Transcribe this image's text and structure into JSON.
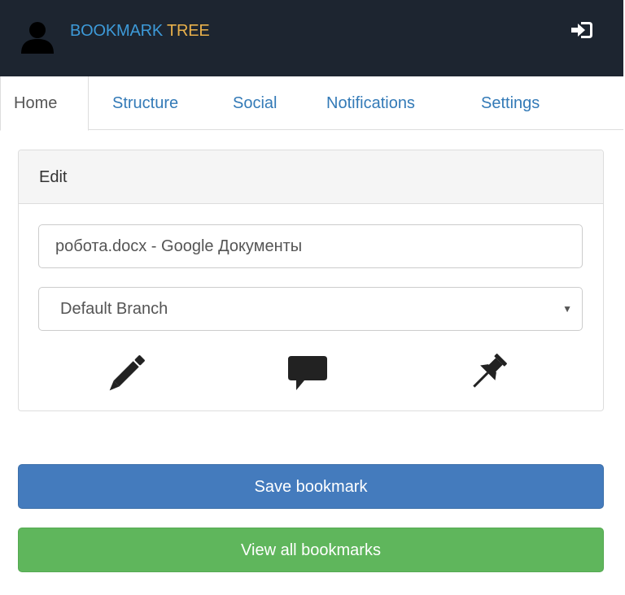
{
  "header": {
    "brand_part1": "BOOKMARK",
    "brand_part2": "TREE",
    "brand_color_1": "#3d9ad8",
    "brand_color_2": "#e8b04a",
    "background_color": "#1d2530",
    "avatar_icon": "user-icon",
    "logout_icon": "sign-in-icon"
  },
  "tabs": [
    {
      "label": "Home",
      "active": true
    },
    {
      "label": "Structure",
      "active": false
    },
    {
      "label": "Social",
      "active": false
    },
    {
      "label": "Notifications",
      "active": false
    },
    {
      "label": "Settings",
      "active": false
    }
  ],
  "panel": {
    "heading": "Edit",
    "title_value": "робота.docx - Google Документы",
    "branch_selected": "Default Branch",
    "tools": [
      "pencil-icon",
      "comment-icon",
      "pin-icon"
    ]
  },
  "actions": {
    "save_label": "Save bookmark",
    "save_color": "#447bbd",
    "view_label": "View all bookmarks",
    "view_color": "#5fb65c"
  }
}
